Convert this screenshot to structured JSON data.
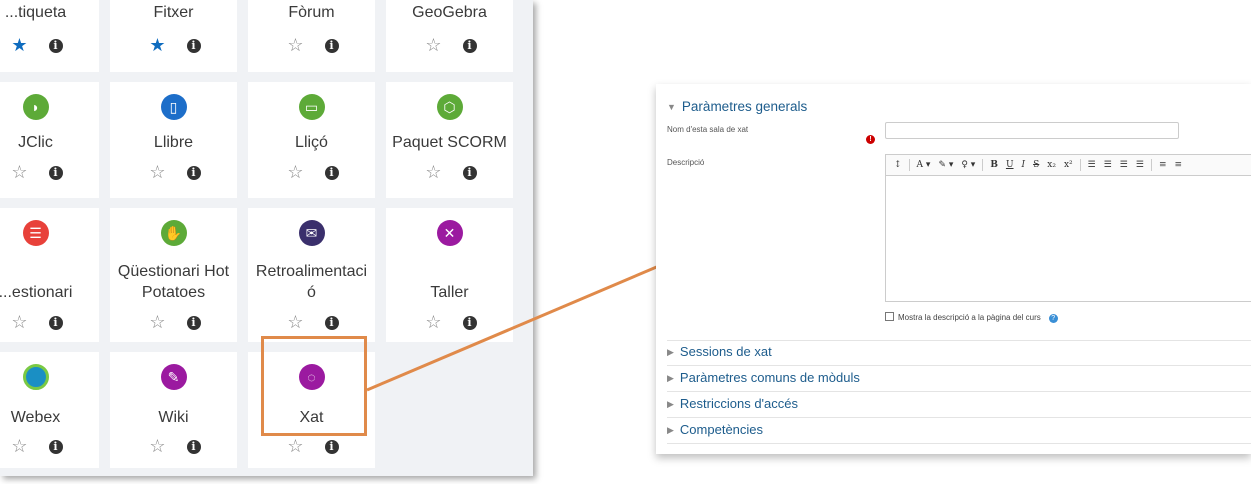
{
  "chooser": {
    "tiles": [
      {
        "name": "...tiqueta",
        "icon": "label-icon",
        "favorite": true
      },
      {
        "name": "Fitxer",
        "icon": "file-icon",
        "favorite": true
      },
      {
        "name": "Fòrum",
        "icon": "forum-icon",
        "favorite": false
      },
      {
        "name": "GeoGebra",
        "icon": "geogebra-icon",
        "favorite": false
      },
      {
        "name": "JClic",
        "icon": "jclic-icon",
        "favorite": false
      },
      {
        "name": "Llibre",
        "icon": "book-icon",
        "favorite": false
      },
      {
        "name": "Lliçó",
        "icon": "lesson-icon",
        "favorite": false
      },
      {
        "name": "Paquet SCORM",
        "icon": "scorm-icon",
        "favorite": false
      },
      {
        "name": "...estionari",
        "icon": "quiz-icon",
        "favorite": false
      },
      {
        "name": "Qüestionari Hot Potatoes",
        "name_line1": "Qüestionari Hot",
        "name_line2": "Potatoes",
        "icon": "hotpot-icon",
        "favorite": false
      },
      {
        "name": "Retroalimentació",
        "name_line1": "Retroalimentaci",
        "name_line2": "ó",
        "icon": "feedback-icon",
        "favorite": false
      },
      {
        "name": "Taller",
        "icon": "workshop-icon",
        "favorite": false
      },
      {
        "name": "Webex",
        "icon": "webex-icon",
        "favorite": false
      },
      {
        "name": "Wiki",
        "icon": "wiki-icon",
        "favorite": false
      },
      {
        "name": "Xat",
        "icon": "chat-icon",
        "favorite": false
      }
    ],
    "colors": {
      "orange": "#e08a4a",
      "green": "#5daa38",
      "blue": "#1d6ec9",
      "red": "#e8413a",
      "navy": "#3a2f6c",
      "purple": "#9b1aa0"
    }
  },
  "panel": {
    "general_heading": "Paràmetres generals",
    "name_label": "Nom d'esta sala de xat",
    "description_label": "Descripció",
    "show_description": "Mostra la descripció a la pàgina del curs",
    "toolbar": [
      "↕",
      "A ▾",
      "✎ ▾",
      "♀ ▾",
      "B",
      "U",
      "I",
      "S",
      "x₂",
      "x²",
      "☰",
      "☰",
      "☰",
      "☰",
      "≡",
      "≡"
    ],
    "sections": [
      "Sessions de xat",
      "Paràmetres comuns de mòduls",
      "Restriccions d'accés",
      "Competències"
    ]
  }
}
